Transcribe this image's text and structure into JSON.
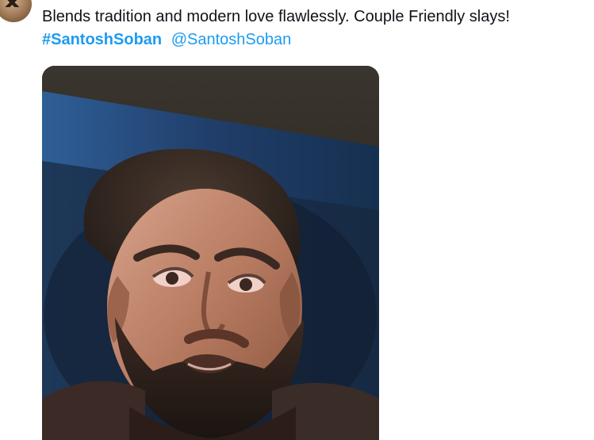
{
  "tweet": {
    "text": "Blends tradition and modern love flawlessly. Couple Friendly slays!",
    "hashtag": "#SantoshSoban",
    "mention": "@SantoshSoban"
  },
  "icons": {
    "avatar": "profile-avatar",
    "media": "video-frame-portrait"
  },
  "colors": {
    "link": "#1d9bf0",
    "text": "#0f1419",
    "screen_blue": "#1b3a66"
  }
}
